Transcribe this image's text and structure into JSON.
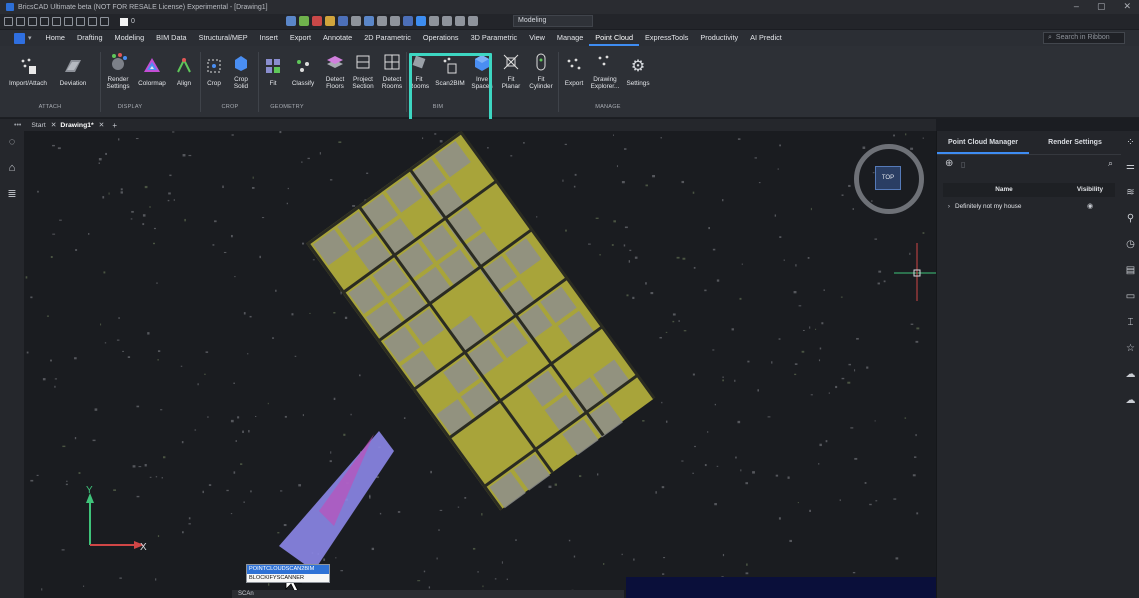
{
  "window": {
    "title": "BricsCAD Ultimate beta (NOT FOR RESALE License) Experimental - [Drawing1]",
    "controls": [
      "–",
      "▢",
      "✕"
    ]
  },
  "qat": {
    "layer_name": "0",
    "workspace": "Modeling"
  },
  "ribbon_tabs": [
    "Home",
    "Drafting",
    "Modeling",
    "BIM Data",
    "Structural/MEP",
    "Insert",
    "Export",
    "Annotate",
    "2D Parametric",
    "Operations",
    "3D Parametric",
    "View",
    "Manage",
    "Point Cloud",
    "ExpressTools",
    "Productivity",
    "AI Predict"
  ],
  "active_tab": "Point Cloud",
  "search_ribbon": "Search in Ribbon",
  "ribbon_tools": {
    "import_attach": "Import/Attach",
    "deviation": "Deviation",
    "render_settings": "Render\nSettings",
    "colormap": "Colormap",
    "align": "Align",
    "crop": "Crop",
    "crop_solid": "Crop\nSolid",
    "fit": "Fit",
    "classify": "Classify",
    "detect_floors": "Detect\nFloors",
    "project_section": "Project\nSection",
    "detect_rooms": "Detect\nRooms",
    "fit_rooms": "Fit\nRooms",
    "scan2bim": "Scan2BIM",
    "invert_spaces": "Inve\nSpaces",
    "fit_planar": "Fit\nPlanar",
    "fit_cylinder": "Fit\nCylinder",
    "export": "Export",
    "drawing_explorer": "Drawing\nExplorer...",
    "settings": "Settings"
  },
  "ribbon_groups": {
    "attach": "ATTACH",
    "display": "DISPLAY",
    "crop": "CROP",
    "geometry": "GEOMETRY",
    "bim": "BIM",
    "manage": "MANAGE"
  },
  "doc_tabs": {
    "more": "•••",
    "start": "Start",
    "drawing": "Drawing1*",
    "close": "✕",
    "new": "+"
  },
  "viewcube_label": "TOP",
  "axis_labels": {
    "x": "X",
    "y": "Y"
  },
  "autocomplete": [
    "POINTCLOUDSCAN2BIM",
    "BLOCKIFYSCANNER"
  ],
  "command_line": "SCAn",
  "panel": {
    "tabs": [
      "Point Cloud Manager",
      "Render Settings"
    ],
    "columns": {
      "name": "Name",
      "visibility": "Visibility"
    },
    "rows": [
      {
        "name": "Definitely not my house",
        "visible": true
      }
    ]
  },
  "colors": {
    "accent": "#3e8cf2",
    "highlight_box": "#3dd6c2",
    "pointcloud_main": "#a8a43a",
    "pointcloud_cone": "#8c87e8"
  }
}
